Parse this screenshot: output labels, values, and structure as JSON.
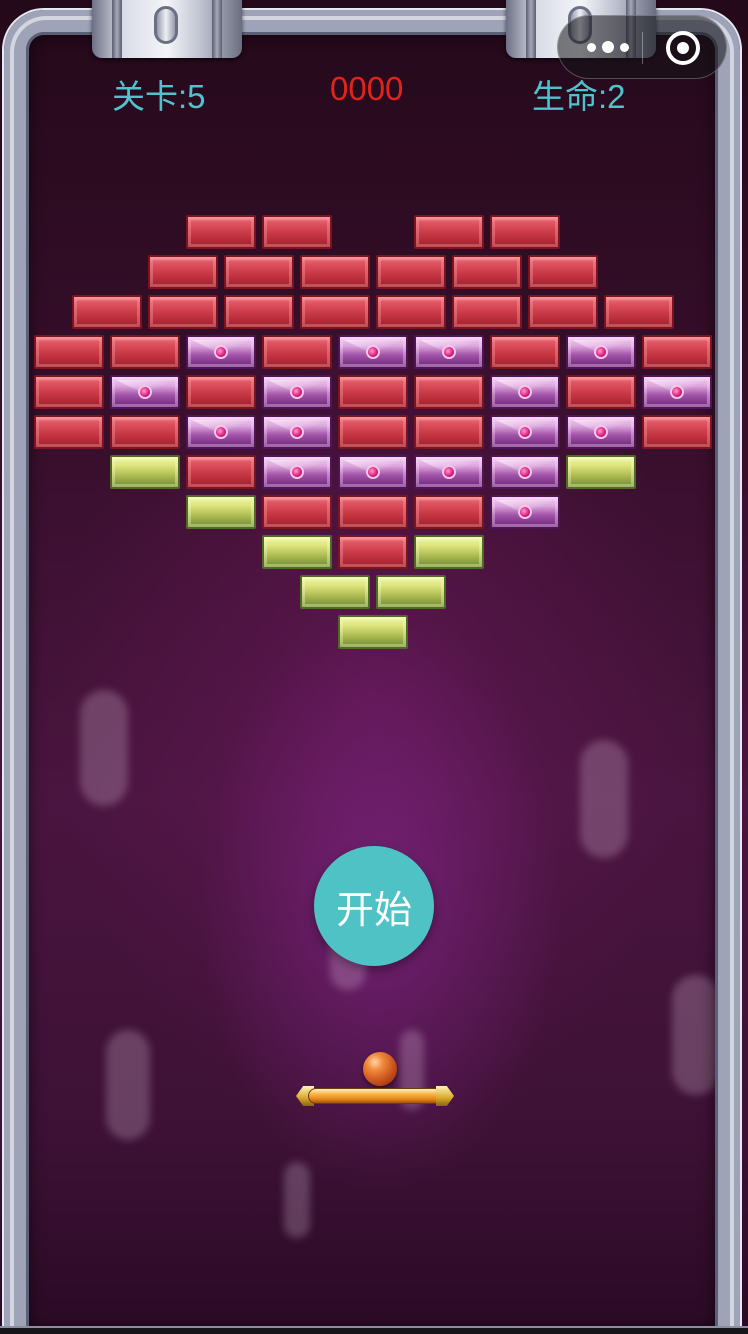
{
  "hud": {
    "level_text": "关卡:5",
    "score_text": "0000",
    "lives_text": "生命:2"
  },
  "start_button": {
    "label": "开始"
  },
  "capsule": {
    "more_icon": "more-dots-icon",
    "close_icon": "target-circle-icon"
  },
  "colors": {
    "hud_text": "#4fc3cd",
    "score_text": "#e0241c",
    "start_button_bg": "#4fc2c6",
    "brick_red": "#c93845",
    "brick_purple": "#a254a8",
    "brick_yellow": "#a9b850"
  },
  "bricks": {
    "legend": {
      "R": "red",
      "P": "purple-gem",
      "Y": "yellow"
    },
    "rows": [
      "..RR.RR..",
      ".RRRRRR.",
      "RRRRRRRR",
      "RRPRPPRPR",
      "RPRPRRPRP",
      "RRPPRRPPR",
      ".YRPPPPY.",
      "..YRRRP..",
      "...YRY...",
      "YY",
      "Y"
    ]
  }
}
